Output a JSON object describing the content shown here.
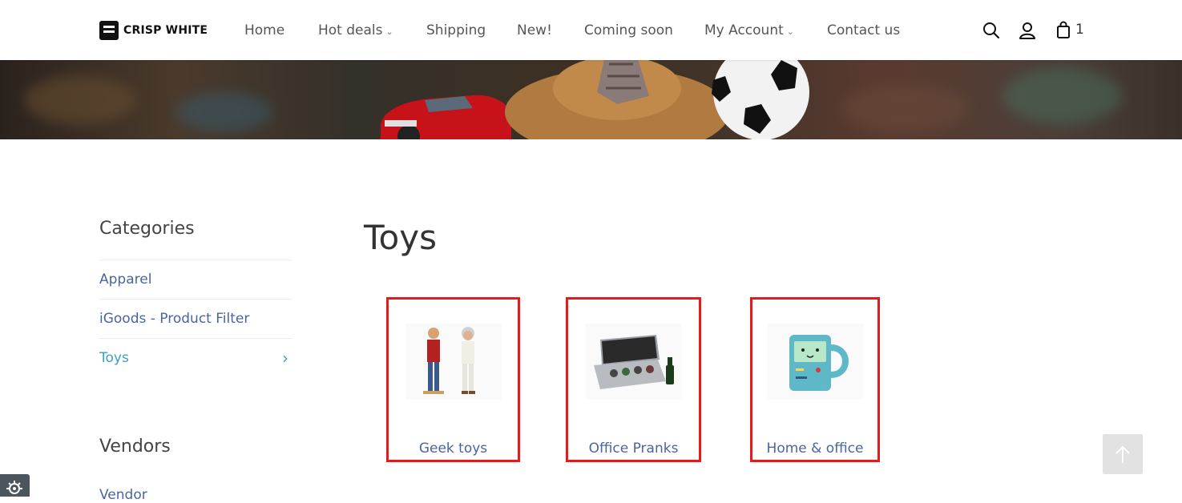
{
  "header": {
    "logo_text": "CRISP WHITE",
    "nav": [
      {
        "label": "Home",
        "has_caret": false
      },
      {
        "label": "Hot deals",
        "has_caret": true
      },
      {
        "label": "Shipping",
        "has_caret": false
      },
      {
        "label": "New!",
        "has_caret": false
      },
      {
        "label": "Coming soon",
        "has_caret": false
      },
      {
        "label": "My Account",
        "has_caret": true
      },
      {
        "label": "Contact us",
        "has_caret": false
      }
    ],
    "cart_count": "1",
    "icons": [
      "search-icon",
      "user-icon",
      "shopping-bag-icon"
    ]
  },
  "sidebar": {
    "categories_heading": "Categories",
    "categories": [
      {
        "label": "Apparel"
      },
      {
        "label": "iGoods - Product Filter"
      },
      {
        "label": "Toys",
        "active": true
      }
    ],
    "vendors_heading": "Vendors",
    "vendors": [
      {
        "label": "Vendor"
      }
    ]
  },
  "main": {
    "title": "Toys",
    "subcategories": [
      {
        "label": "Geek toys",
        "icon": "figurines-icon"
      },
      {
        "label": "Office Pranks",
        "icon": "briefcase-icon"
      },
      {
        "label": "Home & office",
        "icon": "mug-icon"
      }
    ]
  },
  "colors": {
    "link": "#4a64a0",
    "active_link": "#3aa0c8",
    "highlight_border": "#e51a1a"
  }
}
